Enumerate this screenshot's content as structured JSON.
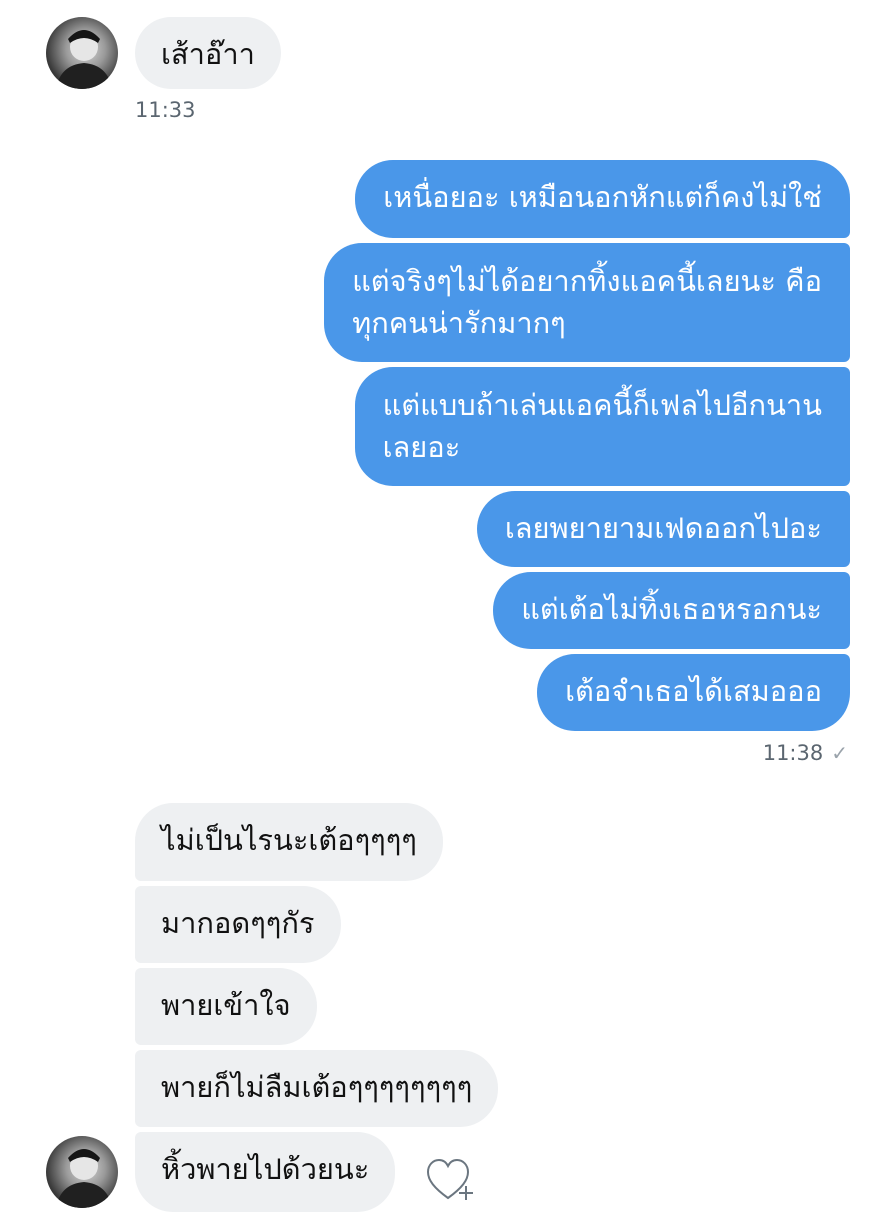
{
  "top_group": {
    "message": "เส้าอ๊าา",
    "time": "11:33"
  },
  "sent_group": {
    "messages": [
      "เหนื่อยอะ เหมือนอกหักแต่ก็คงไม่ใช่",
      "แต่จริงๆไม่ได้อยากทิ้งแอคนี้เลยนะ คือ",
      "ทุกคนน่ารักมากๆ",
      "แต่แบบถ้าเล่นแอคนี้ก็เฟลไปอีกนาน",
      "เลยอะ",
      "เลยพยายามเฟดออกไปอะ",
      "แต่เต้อไม่ทิ้งเธอหรอกนะ",
      "เต้อจำเธอได้เสมอออ"
    ],
    "time": "11:38",
    "status_icon": "single-check-icon",
    "status_glyph": "✓"
  },
  "received_group": {
    "messages": [
      "ไม่เป็นไรนะเต้อๆๆๆๆ",
      "มากอดๆๆกัร",
      "พายเข้าใจ",
      "พายก็ไม่ลืมเต้อๆๆๆๆๆๆๆๆ",
      "หิ้วพายไปด้วยนะ"
    ]
  },
  "reaction": {
    "icon": "heart-add-icon"
  },
  "colors": {
    "sent_bubble": "#4a97e9",
    "received_bubble": "#eef0f2",
    "timestamp": "#5b6670"
  }
}
